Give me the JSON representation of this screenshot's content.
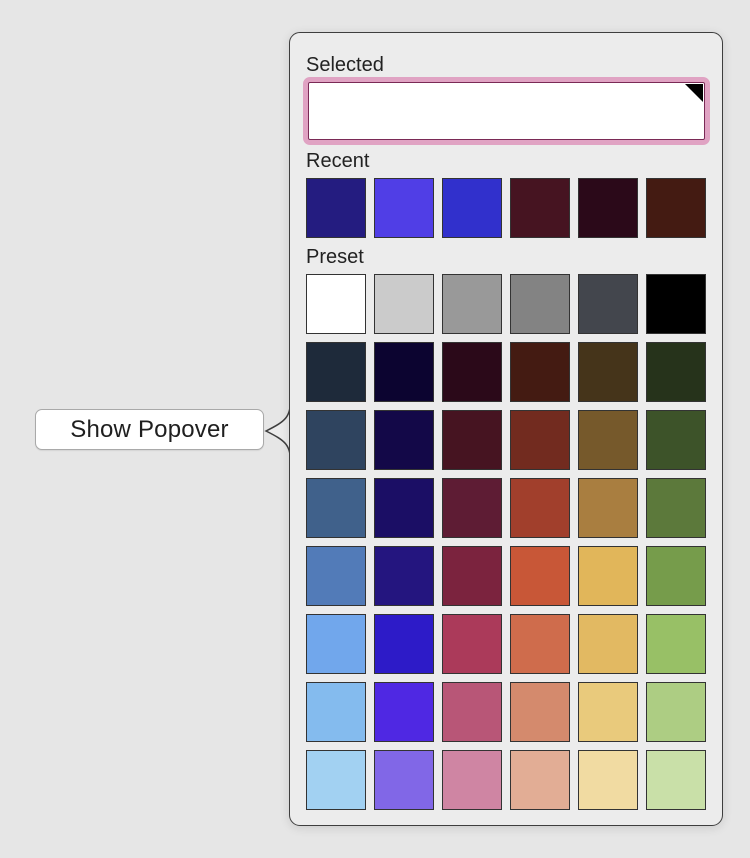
{
  "button": {
    "label": "Show Popover"
  },
  "popover": {
    "selected": {
      "label": "Selected",
      "value_color": "#ffffff",
      "highlight_color": "#e0a3c3"
    },
    "recent": {
      "label": "Recent",
      "colors": [
        "#241c80",
        "#503ee6",
        "#3130cc",
        "#461421",
        "#2b0919",
        "#441b12"
      ]
    },
    "preset": {
      "label": "Preset",
      "rows": [
        [
          "#ffffff",
          "#cbcbcb",
          "#999999",
          "#838383",
          "#43464d",
          "#000000"
        ],
        [
          "#1e2a3a",
          "#0c0430",
          "#2b0919",
          "#441b12",
          "#45341a",
          "#26331b"
        ],
        [
          "#2f445f",
          "#130848",
          "#461421",
          "#722b1f",
          "#76592b",
          "#3d5329"
        ],
        [
          "#40618b",
          "#1b0e65",
          "#5e1c34",
          "#a13f2c",
          "#a97e40",
          "#5c793b"
        ],
        [
          "#527bb8",
          "#24157f",
          "#7b233e",
          "#c85737",
          "#e1b65a",
          "#769c4b"
        ],
        [
          "#71a7ec",
          "#2d1bc8",
          "#ab3a5a",
          "#cf6c4c",
          "#e2b962",
          "#98c066"
        ],
        [
          "#84bbee",
          "#4f28e3",
          "#b85677",
          "#d48a6d",
          "#e9ca7c",
          "#adcd83"
        ],
        [
          "#a2d1f2",
          "#8167e7",
          "#cf85a3",
          "#e2ad95",
          "#f1dba2",
          "#c9e0a8"
        ]
      ]
    }
  }
}
